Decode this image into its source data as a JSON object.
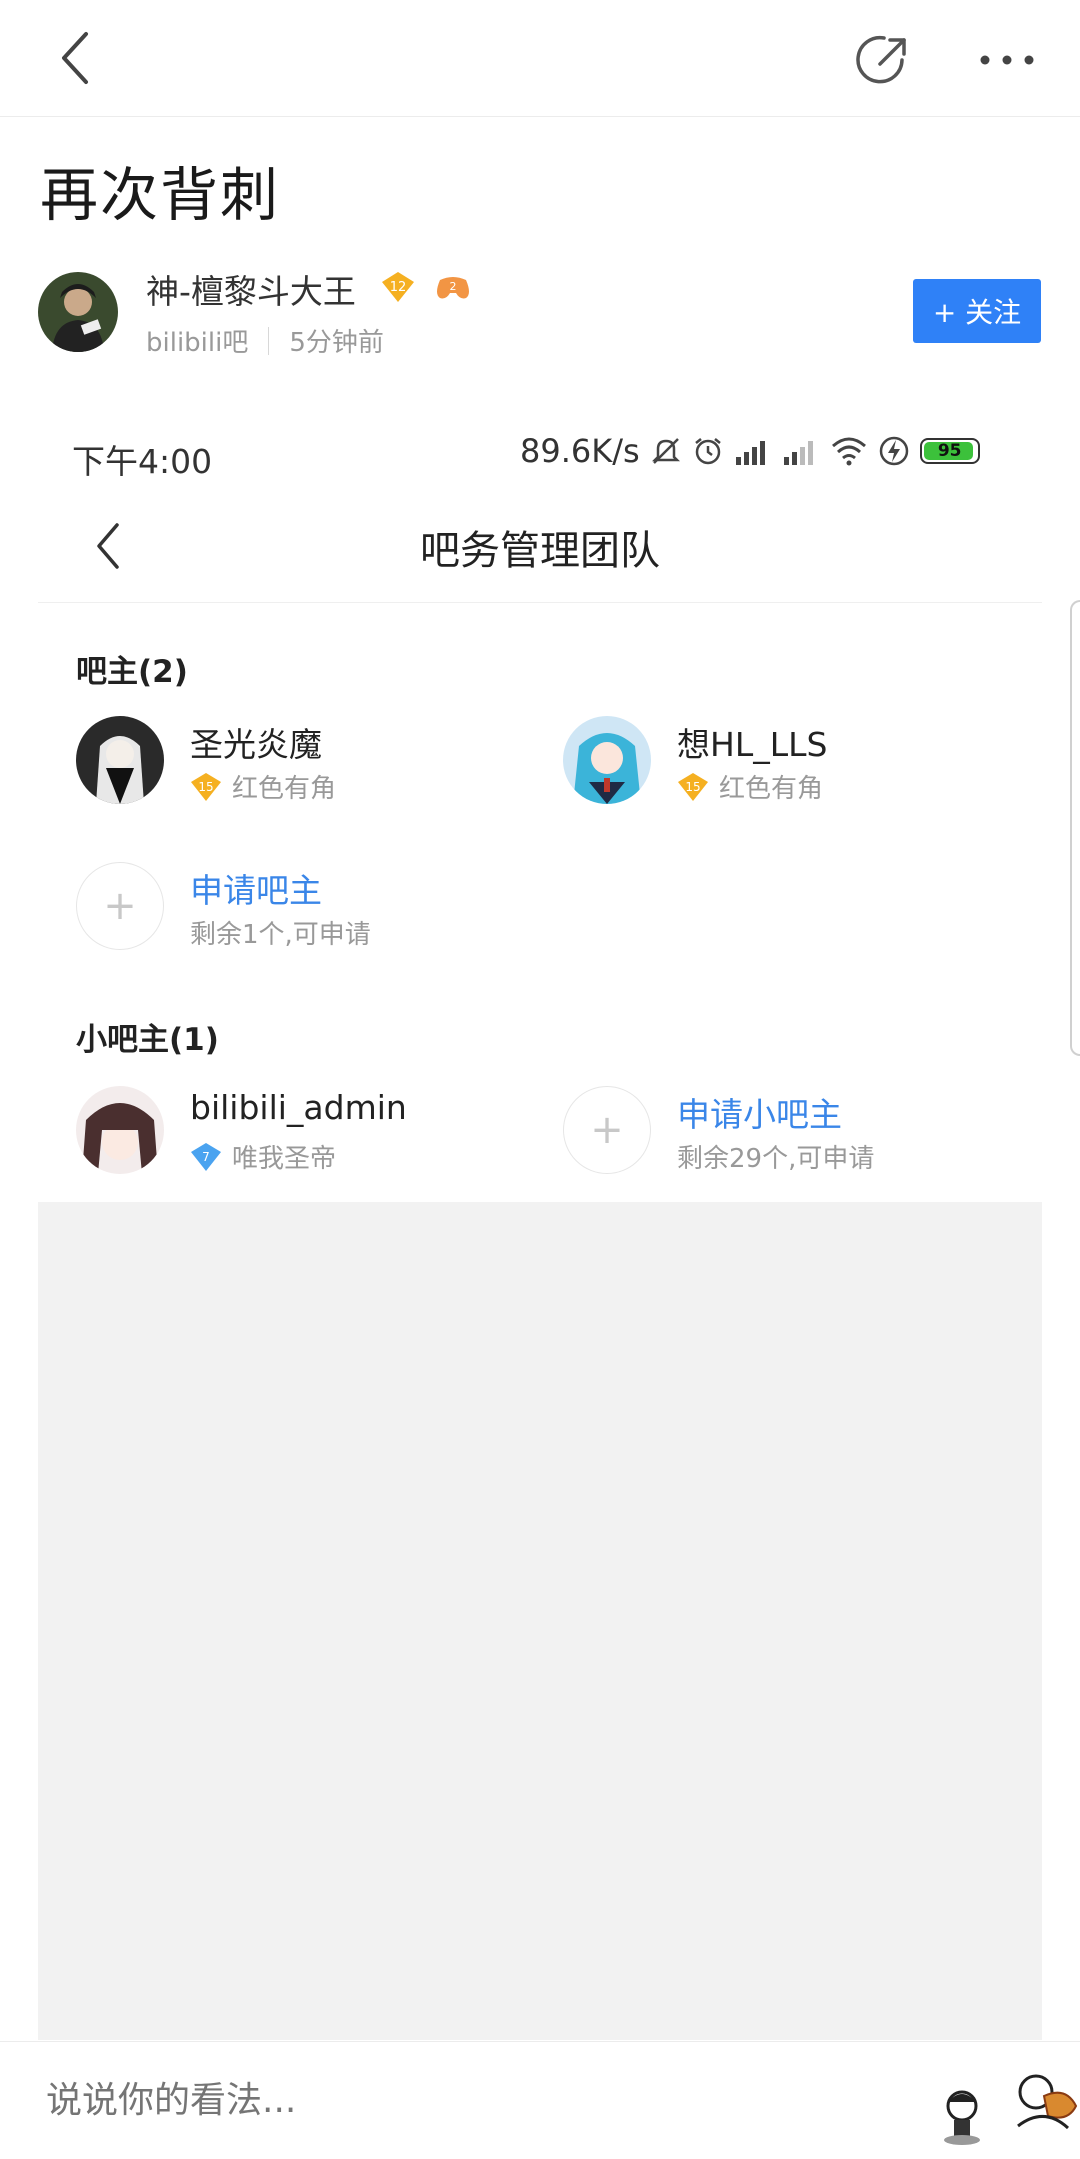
{
  "post": {
    "title": "再次背刺",
    "author": {
      "name": "神-檀黎斗大王",
      "level": "12",
      "badge_level": "2",
      "forum": "bilibili吧",
      "time": "5分钟前"
    },
    "follow_label": "+ 关注"
  },
  "embedded": {
    "status": {
      "time": "下午4:00",
      "speed": "89.6K/s",
      "battery": "95",
      "battery_color": "#3cc13b"
    },
    "page_title": "吧务管理团队",
    "owners": {
      "heading": "吧主(2)",
      "members": [
        {
          "name": "圣光炎魔",
          "level": "15",
          "title": "红色有角"
        },
        {
          "name": "想HL_LLS",
          "level": "15",
          "title": "红色有角"
        }
      ],
      "apply": {
        "label": "申请吧主",
        "note": "剩余1个,可申请"
      }
    },
    "sub_owners": {
      "heading": "小吧主(1)",
      "members": [
        {
          "name": "bilibili_admin",
          "level": "7",
          "title": "唯我圣帝"
        }
      ],
      "apply": {
        "label": "申请小吧主",
        "note": "剩余29个,可申请"
      }
    }
  },
  "comment": {
    "placeholder": "说说你的看法..."
  },
  "icons": {
    "back": "back-chevron-icon",
    "share": "share-icon",
    "more": "more-dots-icon",
    "add": "plus-icon"
  },
  "colors": {
    "accent": "#2f81f7",
    "link": "#3a86e8",
    "level_gold": "#f5b021",
    "level_blue": "#4aa3f0"
  }
}
